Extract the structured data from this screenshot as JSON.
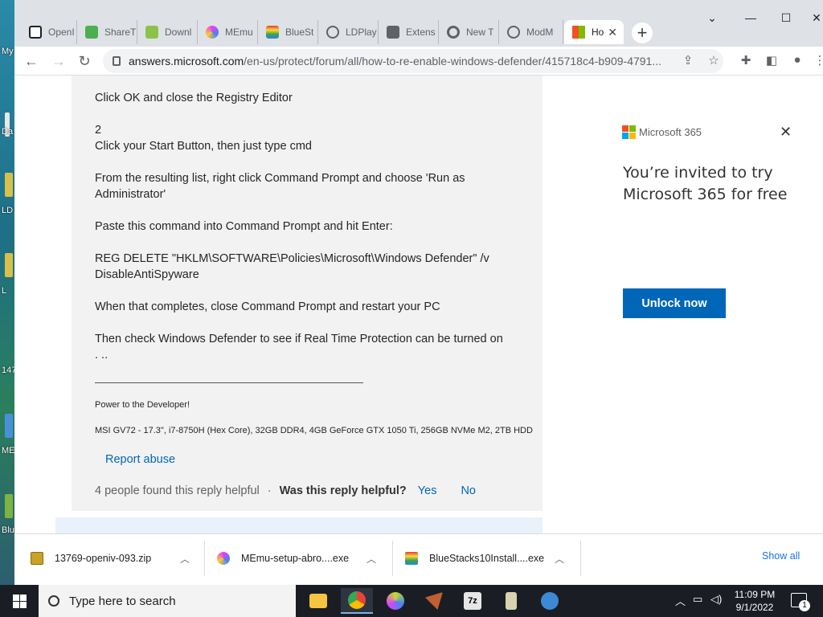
{
  "desktop": {
    "labels": [
      "My",
      "Da",
      "LD",
      "L",
      "147",
      "ME",
      "Blu"
    ]
  },
  "browser": {
    "tabs": [
      {
        "label": "OpenI",
        "color": "#202124"
      },
      {
        "label": "ShareT",
        "color": "#4caf50"
      },
      {
        "label": "Downl",
        "color": "#8bc34a"
      },
      {
        "label": "MEmu",
        "color": "#e040fb"
      },
      {
        "label": "BlueSt",
        "color": "#7cb342"
      },
      {
        "label": "LDPlay",
        "color": "#5f6368"
      },
      {
        "label": "Extens",
        "color": "#5f6368"
      },
      {
        "label": "New T",
        "color": "#5f6368"
      },
      {
        "label": "ModM",
        "color": "#5f6368"
      },
      {
        "label": "Ho",
        "color": "#f25022"
      }
    ],
    "url_host": "answers.microsoft.com",
    "url_path": "/en-us/protect/forum/all/how-to-re-enable-windows-defender/415718c4-b909-4791...",
    "window_controls": {
      "min": "⌄",
      "minimize": "—",
      "maximize": "☐",
      "close": "✕"
    }
  },
  "post": {
    "lines": [
      "Click OK and close the Registry Editor",
      "2",
      "Click your Start Button, then just type cmd",
      "From the resulting list, right click Command Prompt and choose 'Run as Administrator'",
      "Paste this command into Command Prompt and hit Enter:",
      "REG DELETE \"HKLM\\SOFTWARE\\Policies\\Microsoft\\Windows Defender\" /v DisableAntiSpyware",
      "When that completes, close Command Prompt and restart your PC",
      "Then check Windows Defender to see if Real Time Protection can be turned on",
      ". .."
    ],
    "signature_1": "Power to the Developer!",
    "signature_2": "MSI GV72 - 17.3\", i7-8750H (Hex Core), 32GB DDR4, 4GB GeForce GTX 1050 Ti, 256GB NVMe M2, 2TB HDD",
    "report_abuse": "Report abuse",
    "helpful_count": "4 people found this reply helpful",
    "helpful_question": "Was this reply helpful?",
    "yes": "Yes",
    "no": "No"
  },
  "promo": {
    "brand": "Microsoft 365",
    "headline": "You’re invited to try Microsoft 365 for free",
    "button": "Unlock now",
    "close": "✕"
  },
  "downloads": {
    "items": [
      {
        "name": "13769-openiv-093.zip",
        "color": "#c9a227"
      },
      {
        "name": "MEmu-setup-abro....exe",
        "color": "#e040fb"
      },
      {
        "name": "BlueStacks10Install....exe",
        "color": "#7cb342"
      }
    ],
    "show_all": "Show all",
    "close": "✕"
  },
  "taskbar": {
    "search_placeholder": "Type here to search",
    "apps": [
      {
        "name": "file-explorer",
        "color": "#f4c542"
      },
      {
        "name": "chrome",
        "color": "#4285f4"
      },
      {
        "name": "memu",
        "color": "#c8d92a"
      },
      {
        "name": "app-hawk",
        "color": "#c06030"
      },
      {
        "name": "7zip",
        "color": "#e6e6e6"
      },
      {
        "name": "installer",
        "color": "#d8d2b0"
      },
      {
        "name": "app-gear",
        "color": "#3c8ad6"
      }
    ],
    "time": "11:09 PM",
    "date": "9/1/2022",
    "notification_count": "1"
  }
}
